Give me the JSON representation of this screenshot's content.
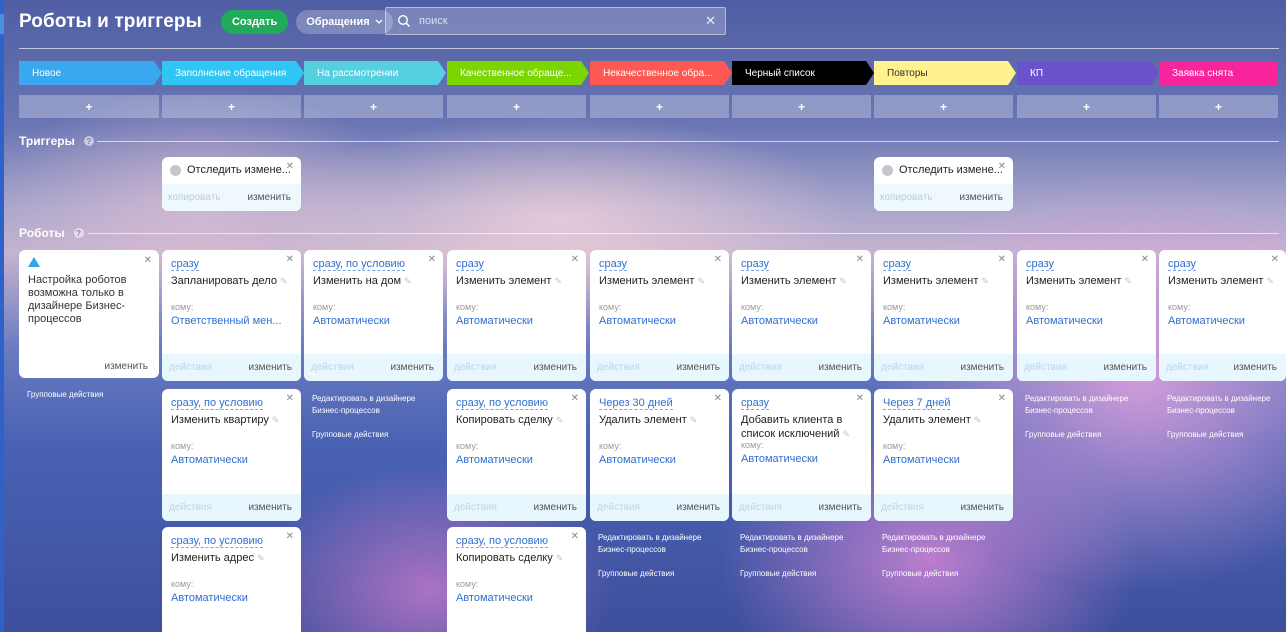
{
  "header": {
    "title": "Роботы и триггеры",
    "create_label": "Создать",
    "filter_label": "Обращения",
    "search_placeholder": "поиск"
  },
  "stages": [
    {
      "name": "Новое",
      "color": "#39a8ef"
    },
    {
      "name": "Заполнение обращения",
      "color": "#2fc6f6"
    },
    {
      "name": "На рассмотрении",
      "color": "#55d0e0"
    },
    {
      "name": "Качественное обраще...",
      "color": "#7bd500"
    },
    {
      "name": "Некачественное обра...",
      "color": "#ff5752"
    },
    {
      "name": "Черный список",
      "color": "#000000"
    },
    {
      "name": "Повторы",
      "color": "#fff28f"
    },
    {
      "name": "КП",
      "color": "#6b52cc"
    },
    {
      "name": "Заявка снята",
      "color": "#f7249c"
    }
  ],
  "add_label": "+",
  "triggers": {
    "title": "Триггеры",
    "items": [
      {
        "name": "Отследить измене...",
        "copy_label": "копировать",
        "edit_label": "изменить"
      },
      {
        "name": "Отследить измене...",
        "copy_label": "копировать",
        "edit_label": "изменить"
      }
    ]
  },
  "robots": {
    "title": "Роботы",
    "notice": "Настройка роботов возможна только в дизайнере Бизнес-процессов",
    "notice_edit": "изменить",
    "group_actions": "Групповые действия",
    "edit_in_designer": "Редактировать в дизайнере Бизнес-процессов",
    "actions_label": "действия",
    "edit_label": "изменить",
    "to_label": "кому:",
    "cards": [
      {
        "when": "сразу",
        "name": "Запланировать дело",
        "to": "Ответственный мен..."
      },
      {
        "when": "сразу, по условию",
        "name": "Изменить квартиру",
        "to": "Автоматически"
      },
      {
        "when": "сразу, по условию",
        "name": "Изменить адрес",
        "to": "Автоматически"
      },
      {
        "when": "сразу, по условию",
        "name": "Изменить на дом",
        "to": "Автоматически"
      },
      {
        "when": "сразу",
        "name": "Изменить элемент",
        "to": "Автоматически"
      },
      {
        "when": "сразу, по условию",
        "name": "Копировать сделку",
        "to": "Автоматически"
      },
      {
        "when": "сразу, по условию",
        "name": "Копировать сделку",
        "to": "Автоматически"
      },
      {
        "when": "сразу",
        "name": "Изменить элемент",
        "to": "Автоматически"
      },
      {
        "when": "Через 30 дней",
        "name": "Удалить элемент",
        "to": "Автоматически"
      },
      {
        "when": "сразу",
        "name": "Изменить элемент",
        "to": "Автоматически"
      },
      {
        "when": "сразу",
        "name": "Добавить клиента в список исключений",
        "to": "Автоматически"
      },
      {
        "when": "сразу",
        "name": "Изменить элемент",
        "to": "Автоматически"
      },
      {
        "when": "Через 7 дней",
        "name": "Удалить элемент",
        "to": "Автоматически"
      },
      {
        "when": "сразу",
        "name": "Изменить элемент",
        "to": "Автоматически"
      },
      {
        "when": "сразу",
        "name": "Изменить элемент",
        "to": "Автоматически"
      }
    ]
  }
}
